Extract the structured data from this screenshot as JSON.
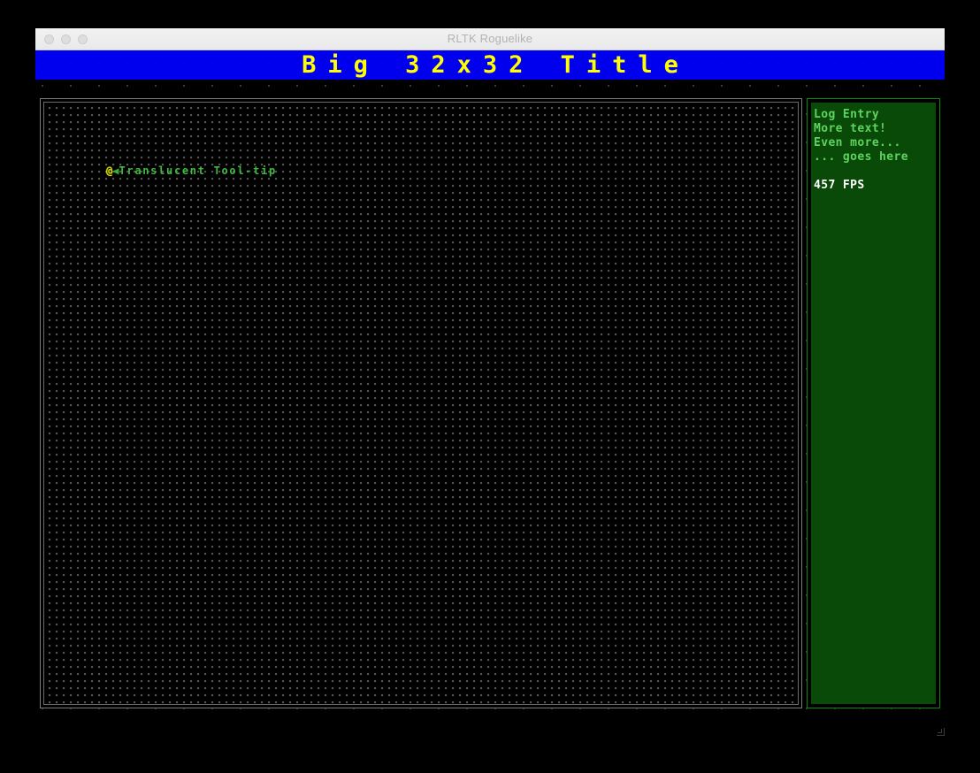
{
  "window": {
    "os_title": "RLTK Roguelike",
    "traffic_lights": [
      "close-button",
      "minimize-button",
      "maximize-button"
    ]
  },
  "banner": {
    "title": "Big 32x32 Title",
    "background_color": "#0000ee",
    "text_color": "#ffff00"
  },
  "map": {
    "grid_dot_color": "#555555",
    "border_color": "#7a7a7a",
    "background_color": "#000000",
    "player": {
      "glyph": "@",
      "color": "#dddd00"
    },
    "tooltip": {
      "arrow_glyph": "◀",
      "text": "Translucent Tool-tip",
      "text_color": "#3fba3f"
    }
  },
  "log_panel": {
    "border_color": "#0a8a0a",
    "background_color": "#0a4a08",
    "entries": [
      "Log Entry",
      "More text!",
      "Even more...",
      "... goes here"
    ],
    "entry_color": "#5fd35f",
    "fps": "457 FPS",
    "fps_color": "#ffffff"
  }
}
